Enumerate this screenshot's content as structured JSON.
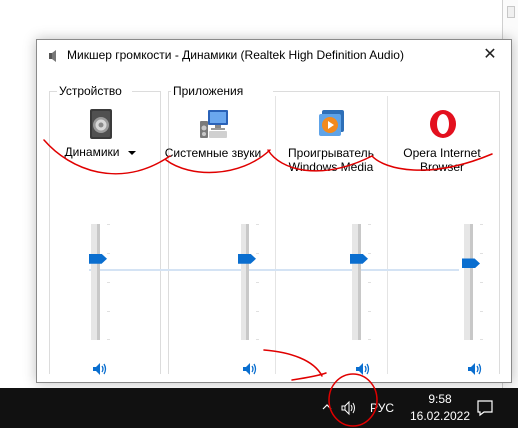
{
  "window": {
    "title": "Микшер громкости - Динамики (Realtek High Definition Audio)",
    "close_glyph": "✕"
  },
  "groups": {
    "device_label": "Устройство",
    "apps_label": "Приложения"
  },
  "device": {
    "name": "Динамики",
    "icon": "speaker-device-icon",
    "volume_level": 0.7
  },
  "apps": [
    {
      "line1": "Системные звуки",
      "line2": "",
      "icon": "system-sounds-icon",
      "volume_level": 0.7
    },
    {
      "line1": "Проигрыватель",
      "line2": "Windows Media",
      "icon": "windows-media-player-icon",
      "volume_level": 0.7
    },
    {
      "line1": "Opera Internet",
      "line2": "Browser",
      "icon": "opera-browser-icon",
      "volume_level": 0.66
    }
  ],
  "taskbar": {
    "lang": "РУС",
    "time": "9:58",
    "date": "16.02.2022"
  },
  "colors": {
    "accent": "#0a6ecf",
    "annotation": "#e00000",
    "taskbar": "#111111"
  }
}
